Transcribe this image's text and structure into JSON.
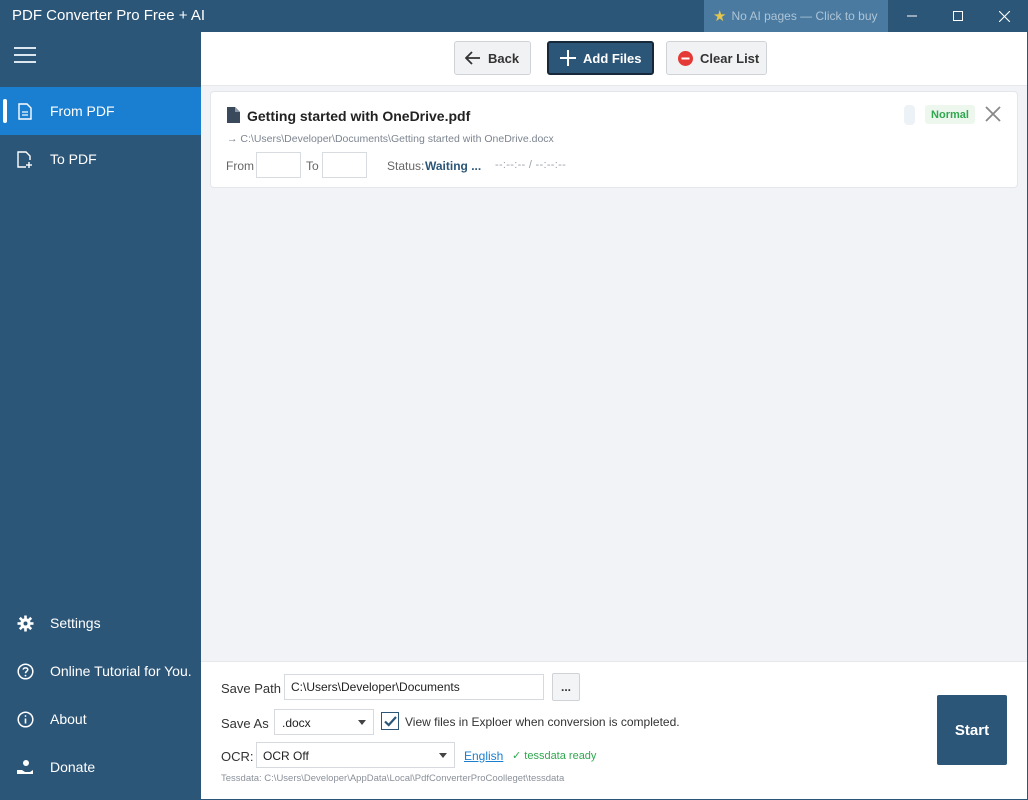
{
  "window": {
    "title": "PDF Converter Pro Free + AI",
    "promo": "No AI pages — Click to buy",
    "minimize": "—",
    "maximize": "☐",
    "close": "✕"
  },
  "sidebar": {
    "items": [
      {
        "label": "From PDF",
        "icon": "document-icon",
        "active": true
      },
      {
        "label": "To PDF",
        "icon": "document-add-icon",
        "active": false
      },
      {
        "label": "Settings",
        "icon": "gear-icon",
        "active": false
      },
      {
        "label": "Online Tutorial for You.",
        "icon": "help-icon",
        "active": false
      },
      {
        "label": "About",
        "icon": "info-icon",
        "active": false
      },
      {
        "label": "Donate",
        "icon": "donate-icon",
        "active": false
      }
    ]
  },
  "toolbar": {
    "back_label": "Back",
    "add_label": "Add Files",
    "clear_label": "Clear List"
  },
  "file": {
    "name": "Getting started with OneDrive.pdf",
    "output_path": "→ C:\\Users\\Developer\\Documents\\Getting started with OneDrive.docx",
    "from_label": "From",
    "from_value": "",
    "to_label": "To",
    "to_value": "",
    "status_label": "Status:",
    "status_value": "Waiting ...",
    "time": "--:--:-- / --:--:--",
    "mode": "Normal"
  },
  "bottom": {
    "save_path_label": "Save Path",
    "save_path_value": "C:\\Users\\Developer\\Documents",
    "browse_label": "...",
    "save_as_label": "Save As",
    "format": ".docx",
    "view_checked": true,
    "view_label": "View files in Exploer when conversion is completed.",
    "ocr_label": "OCR:",
    "ocr_value": "OCR Off",
    "language": "English",
    "tess_status": "✓ tessdata ready",
    "tess_path": "Tessdata: C:\\Users\\Developer\\AppData\\Local\\PdfConverterProCoolleget\\tessdata",
    "start_label": "Start"
  },
  "colors": {
    "primary": "#2c5678",
    "accent": "#1a7fd1",
    "success": "#2fa84f",
    "danger": "#e53935"
  }
}
